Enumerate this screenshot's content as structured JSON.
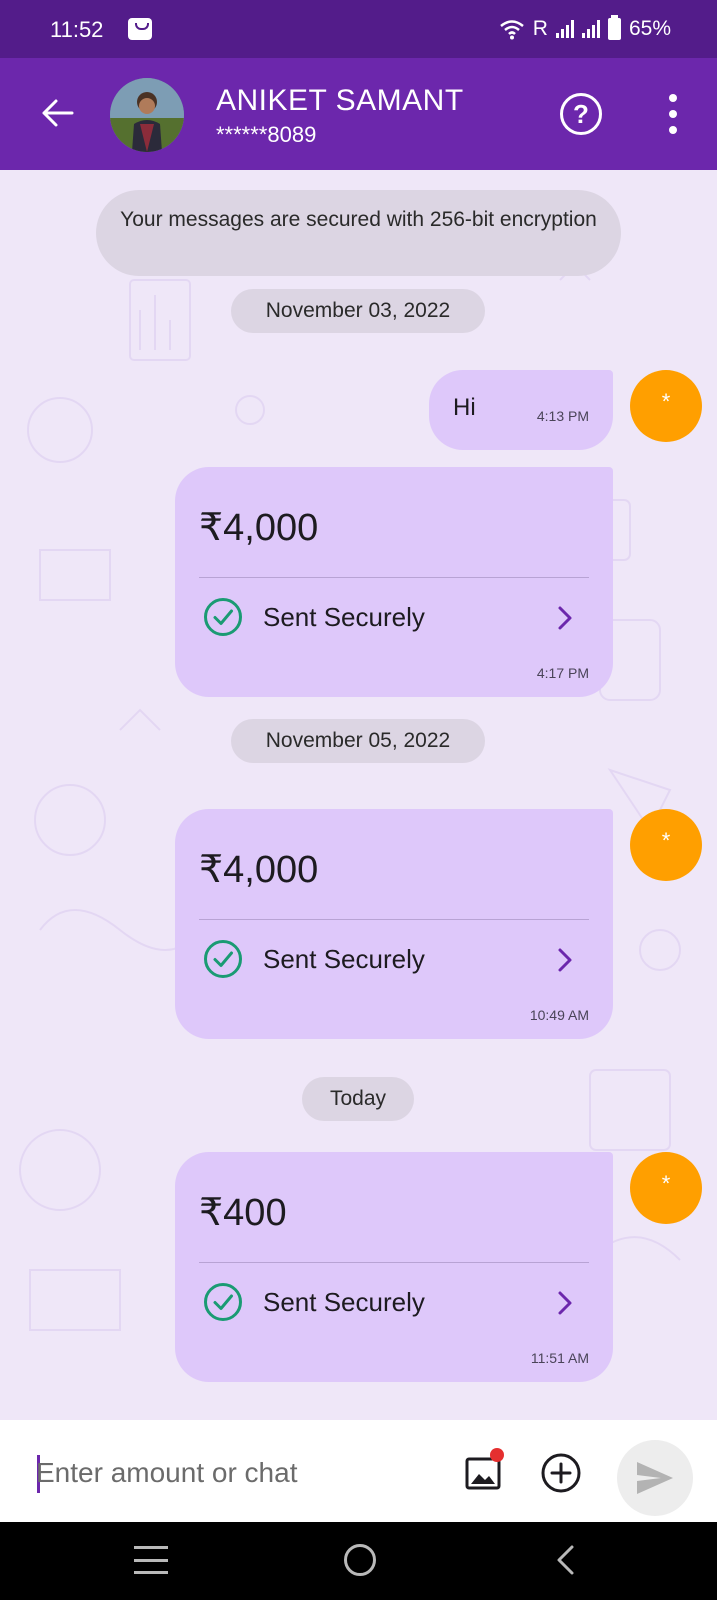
{
  "status_bar": {
    "time": "11:52",
    "network_label": "R",
    "battery": "65%"
  },
  "header": {
    "contact_name": "ANIKET SAMANT",
    "contact_phone": "******8089"
  },
  "chat": {
    "encryption_notice": "Your messages are secured with 256-bit encryption",
    "dates": [
      "November 03, 2022",
      "November 05, 2022",
      "Today"
    ],
    "text_message": {
      "text": "Hi",
      "time": "4:13 PM"
    },
    "payments": [
      {
        "amount": "₹4,000",
        "status": "Sent Securely",
        "time": "4:17 PM"
      },
      {
        "amount": "₹4,000",
        "status": "Sent Securely",
        "time": "10:49 AM"
      },
      {
        "amount": "₹400",
        "status": "Sent Securely",
        "time": "11:51 AM"
      }
    ],
    "self_avatar_symbol": "*"
  },
  "input": {
    "placeholder": "Enter amount or chat"
  },
  "icons": {
    "back": "back-arrow-icon",
    "help": "help-icon",
    "menu": "more-vert-icon",
    "check": "check-circle-icon",
    "chevron": "chevron-right-icon",
    "gallery": "gallery-icon",
    "add": "add-circle-icon",
    "send": "send-icon"
  },
  "colors": {
    "header": "#6c27ac",
    "status_bar": "#531c8a",
    "bubble": "#dec8fa",
    "success": "#1a9b73",
    "avatar": "#ff9f00"
  }
}
